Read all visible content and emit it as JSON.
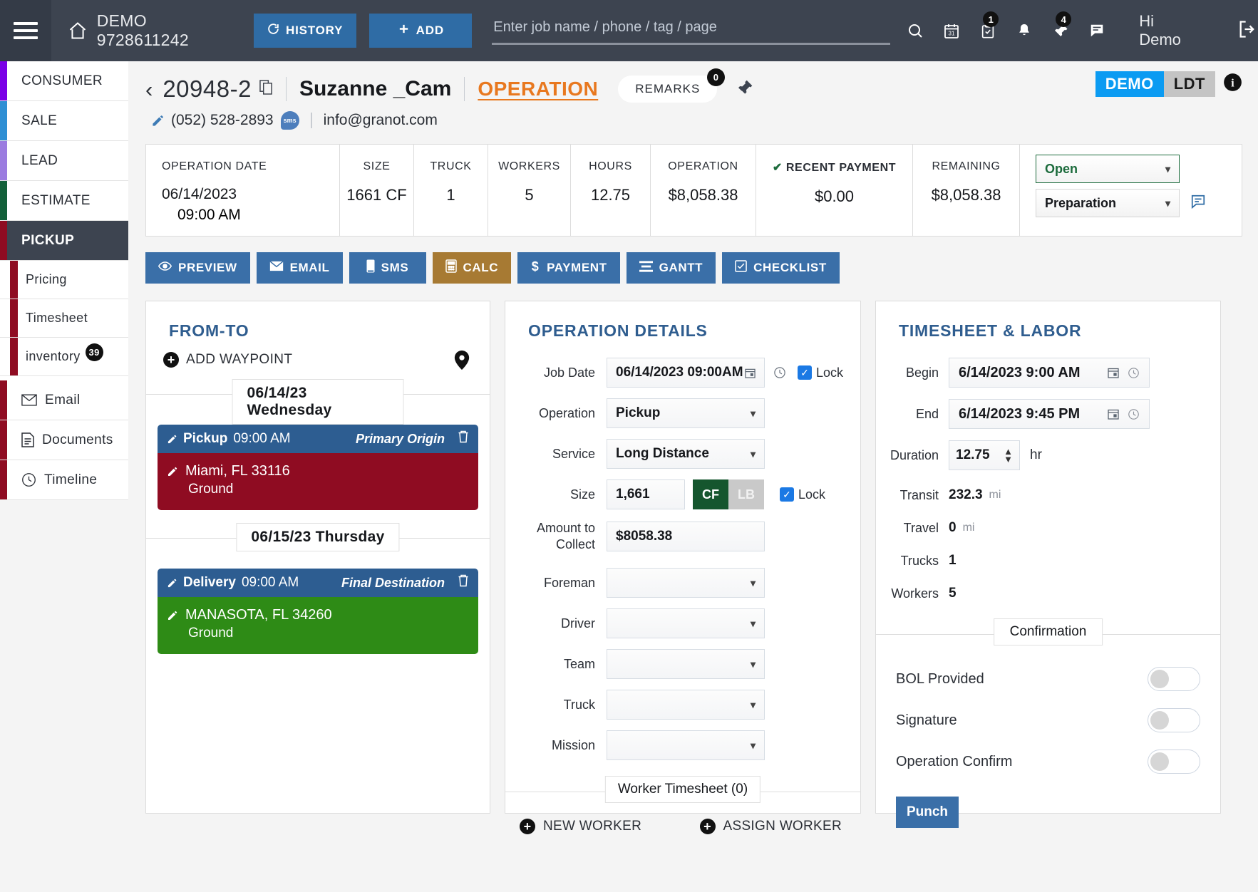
{
  "topbar": {
    "menu_icon": "hamburger-icon",
    "home_icon": "home-icon",
    "brand": "DEMO 9728611242",
    "history_label": "HISTORY",
    "add_label": "ADD",
    "search_placeholder": "Enter job name / phone / tag / page",
    "search_value": "",
    "icons": [
      {
        "name": "search-icon",
        "badge": ""
      },
      {
        "name": "calendar-icon",
        "badge": ""
      },
      {
        "name": "tasks-icon",
        "badge": "1"
      },
      {
        "name": "bell-icon",
        "badge": ""
      },
      {
        "name": "pin-icon",
        "badge": "4"
      },
      {
        "name": "chat-icon",
        "badge": ""
      }
    ],
    "greeting": "Hi Demo",
    "logout_icon": "logout-icon"
  },
  "sidebar": {
    "items": [
      {
        "label": "CONSUMER",
        "color": "#7a00e6",
        "active": false
      },
      {
        "label": "SALE",
        "color": "#2f8fd4",
        "active": false
      },
      {
        "label": "LEAD",
        "color": "#9b7ce0",
        "active": false
      },
      {
        "label": "ESTIMATE",
        "color": "#13603a",
        "active": false
      },
      {
        "label": "PICKUP",
        "color": "#8f0c22",
        "active": true
      }
    ],
    "sub_items": [
      {
        "label": "Pricing",
        "color": "#8f0c22",
        "badge": ""
      },
      {
        "label": "Timesheet",
        "color": "#8f0c22",
        "badge": ""
      },
      {
        "label": "inventory",
        "color": "#8f0c22",
        "badge": "39"
      }
    ],
    "tools": [
      {
        "label": "Email",
        "icon": "envelope-icon",
        "color": "#8f0c22"
      },
      {
        "label": "Documents",
        "icon": "document-icon",
        "color": "#8f0c22"
      },
      {
        "label": "Timeline",
        "icon": "clock-icon",
        "color": "#8f0c22"
      }
    ]
  },
  "job": {
    "back_icon": "chevron-left-icon",
    "number": "20948-2",
    "copy_icon": "copy-icon",
    "customer": "Suzanne _Cam",
    "operation_link": "OPERATION",
    "remarks_label": "REMARKS",
    "remarks_count": "0",
    "pin_icon": "pin-icon",
    "phone": "(052) 528-2893",
    "sms_chip": "sms",
    "email": "info@granot.com",
    "badge_demo": "DEMO",
    "badge_ldt": "LDT",
    "info_icon": "info-icon"
  },
  "summary": {
    "operation_date_label": "OPERATION DATE",
    "operation_date": "06/14/2023",
    "operation_time": "09:00 AM",
    "cells": [
      {
        "label": "SIZE",
        "value": "1661 CF"
      },
      {
        "label": "TRUCK",
        "value": "1"
      },
      {
        "label": "WORKERS",
        "value": "5"
      },
      {
        "label": "HOURS",
        "value": "12.75"
      },
      {
        "label": "OPERATION",
        "value": "$8,058.38"
      },
      {
        "label": "RECENT PAYMENT",
        "value": "$0.00"
      },
      {
        "label": "REMAINING",
        "value": "$8,058.38"
      }
    ],
    "status_primary": "Open",
    "status_secondary": "Preparation",
    "status_color": "#1c6b3c",
    "chat_icon": "chat-icon"
  },
  "actions": [
    {
      "label": "PREVIEW",
      "icon": "eye-icon",
      "color": "#3a6fa8"
    },
    {
      "label": "EMAIL",
      "icon": "envelope-icon",
      "color": "#3a6fa8"
    },
    {
      "label": "SMS",
      "icon": "phone-icon",
      "color": "#3a6fa8"
    },
    {
      "label": "CALC",
      "icon": "calculator-icon",
      "color": "#a77a33"
    },
    {
      "label": "PAYMENT",
      "icon": "dollar-icon",
      "color": "#3a6fa8"
    },
    {
      "label": "GANTT",
      "icon": "bars-icon",
      "color": "#3a6fa8"
    },
    {
      "label": "CHECKLIST",
      "icon": "checklist-icon",
      "color": "#3a6fa8"
    }
  ],
  "from_to": {
    "title": "FROM-TO",
    "add_waypoint": "ADD WAYPOINT",
    "map_icon": "map-pin-icon",
    "day1": "06/14/23 Wednesday",
    "day2": "06/15/23 Thursday",
    "stops": [
      {
        "type": "Pickup",
        "time": "09:00 AM",
        "role": "Primary Origin",
        "address": "Miami, FL 33116",
        "sub": "Ground",
        "body_color": "#8f0c22"
      },
      {
        "type": "Delivery",
        "time": "09:00 AM",
        "role": "Final Destination",
        "address": "MANASOTA, FL 34260",
        "sub": "Ground",
        "body_color": "#2e8b16"
      }
    ]
  },
  "operation_details": {
    "title": "OPERATION DETAILS",
    "job_date_label": "Job Date",
    "job_date": "06/14/2023 09:00AM",
    "job_date_lock": "Lock",
    "operation_label": "Operation",
    "operation_value": "Pickup",
    "service_label": "Service",
    "service_value": "Long Distance",
    "size_label": "Size",
    "size_value": "1,661",
    "unit_cf": "CF",
    "unit_lb": "LB",
    "size_lock": "Lock",
    "amount_label_l1": "Amount to",
    "amount_label_l2": "Collect",
    "amount_value": "$8058.38",
    "foreman_label": "Foreman",
    "foreman_value": "",
    "driver_label": "Driver",
    "driver_value": "",
    "team_label": "Team",
    "team_value": "",
    "truck_label": "Truck",
    "truck_value": "",
    "mission_label": "Mission",
    "mission_value": "",
    "worker_timesheet": "Worker Timesheet (0)",
    "new_worker": "NEW WORKER",
    "assign_worker": "ASSIGN WORKER"
  },
  "timesheet": {
    "title": "TIMESHEET & LABOR",
    "begin_label": "Begin",
    "begin_value": "6/14/2023 9:00 AM",
    "end_label": "End",
    "end_value": "6/14/2023 9:45 PM",
    "duration_label": "Duration",
    "duration_value": "12.75",
    "duration_unit": "hr",
    "stats": [
      {
        "label": "Transit",
        "value": "232.3",
        "unit": "mi"
      },
      {
        "label": "Travel",
        "value": "0",
        "unit": "mi"
      },
      {
        "label": "Trucks",
        "value": "1",
        "unit": ""
      },
      {
        "label": "Workers",
        "value": "5",
        "unit": ""
      }
    ],
    "confirmation_title": "Confirmation",
    "toggles": [
      {
        "label": "BOL Provided",
        "on": false
      },
      {
        "label": "Signature",
        "on": false
      },
      {
        "label": "Operation Confirm",
        "on": false
      }
    ],
    "punch_label": "Punch"
  }
}
